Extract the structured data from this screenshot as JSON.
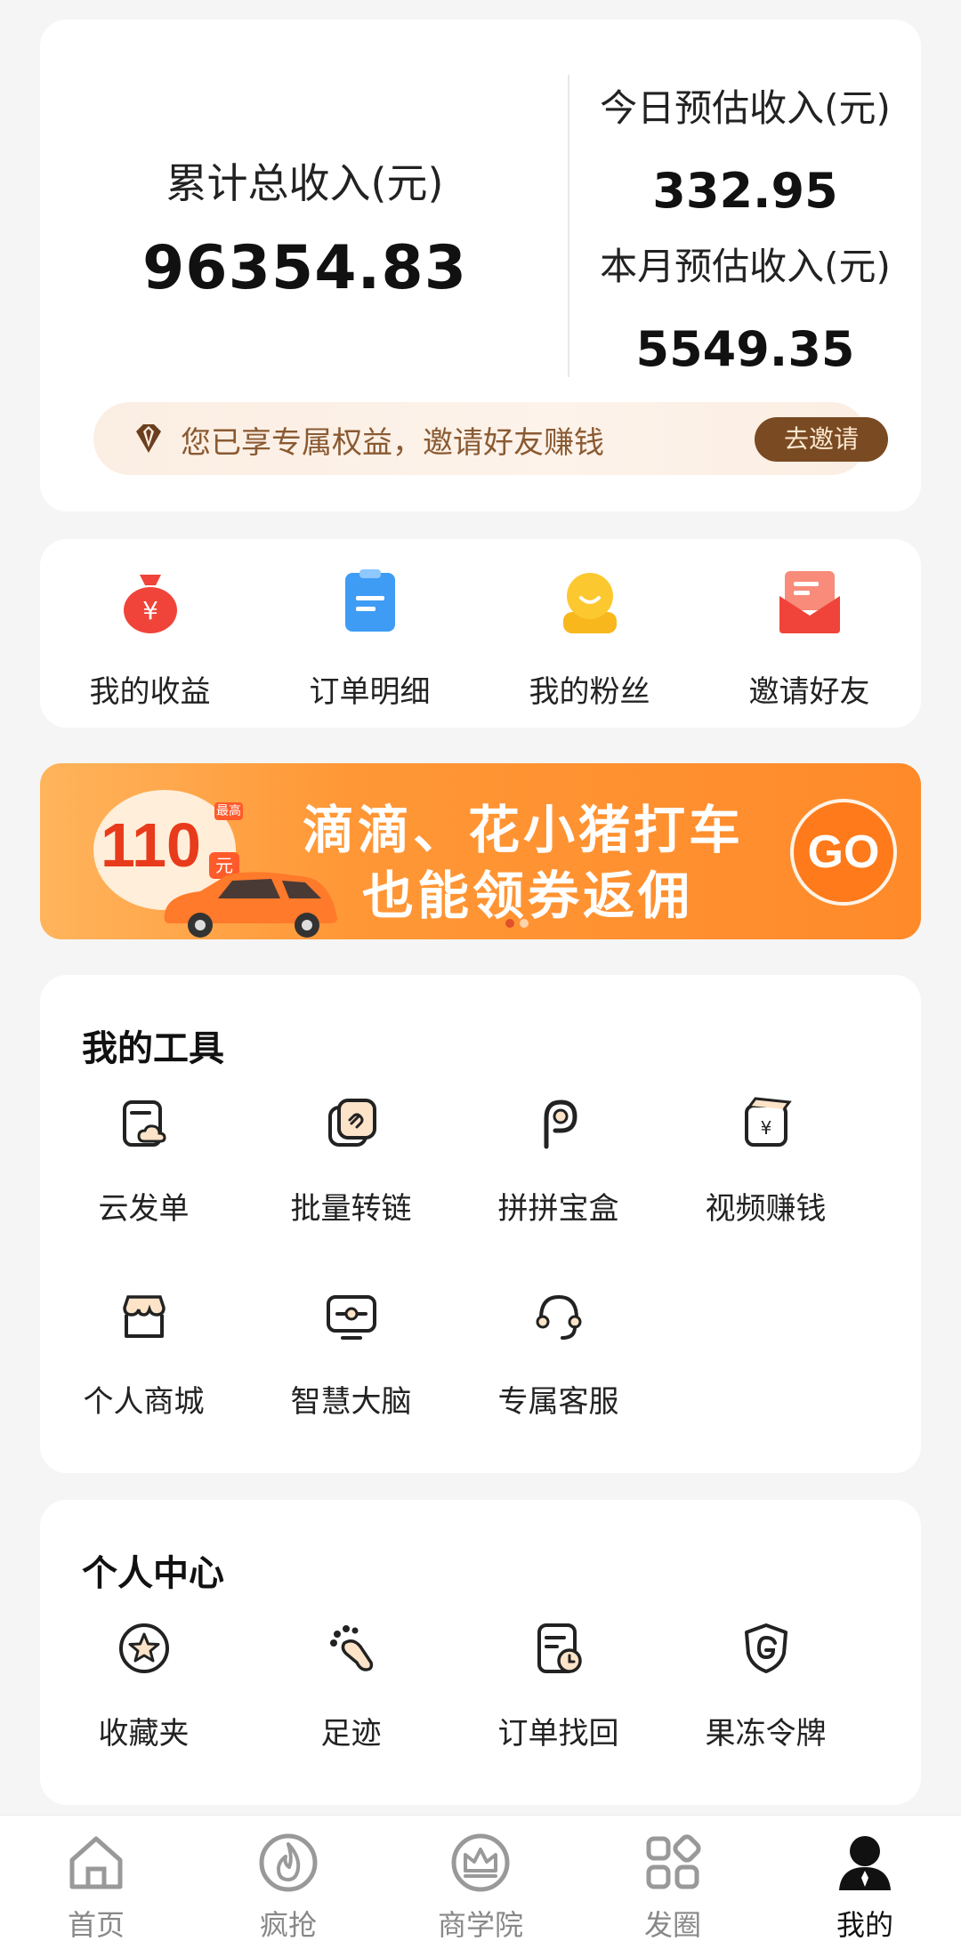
{
  "earnings": {
    "total_label": "累计总收入(元)",
    "total_value": "96354.83",
    "today_label": "今日预估收入(元)",
    "today_value": "332.95",
    "month_label": "本月预估收入(元)",
    "month_value": "5549.35",
    "invite_text": "您已享专属权益，邀请好友赚钱",
    "invite_button": "去邀请"
  },
  "quick_actions": [
    {
      "label": "我的收益",
      "icon": "money-bag-icon",
      "color": "#f0443a"
    },
    {
      "label": "订单明细",
      "icon": "clipboard-icon",
      "color": "#3f9cf5"
    },
    {
      "label": "我的粉丝",
      "icon": "fan-smiley-icon",
      "color": "#f7b71d"
    },
    {
      "label": "邀请好友",
      "icon": "envelope-icon",
      "color": "#f5604a"
    }
  ],
  "promo": {
    "amount": "110",
    "tag": "最高",
    "unit": "元",
    "line1": "滴滴、花小猪打车",
    "line2": "也能领券返佣",
    "go": "GO",
    "slide_count": 2,
    "active_slide": 1
  },
  "tools": {
    "title": "我的工具",
    "items": [
      {
        "label": "云发单",
        "icon": "cloud-doc-icon"
      },
      {
        "label": "批量转链",
        "icon": "link-convert-icon"
      },
      {
        "label": "拼拼宝盒",
        "icon": "pinpin-p-icon"
      },
      {
        "label": "视频赚钱",
        "icon": "video-money-icon"
      },
      {
        "label": "个人商城",
        "icon": "shop-icon"
      },
      {
        "label": "智慧大脑",
        "icon": "brain-screen-icon"
      },
      {
        "label": "专属客服",
        "icon": "headset-icon"
      }
    ]
  },
  "personal_center": {
    "title": "个人中心",
    "items": [
      {
        "label": "收藏夹",
        "icon": "star-icon"
      },
      {
        "label": "足迹",
        "icon": "footprint-icon"
      },
      {
        "label": "订单找回",
        "icon": "order-retrieve-icon"
      },
      {
        "label": "果冻令牌",
        "icon": "shield-g-icon"
      }
    ]
  },
  "bottom_nav": [
    {
      "label": "首页",
      "icon": "home-icon"
    },
    {
      "label": "疯抢",
      "icon": "flame-icon"
    },
    {
      "label": "商学院",
      "icon": "crown-icon"
    },
    {
      "label": "发圈",
      "icon": "grid-icon"
    },
    {
      "label": "我的",
      "icon": "user-icon",
      "active": true
    }
  ],
  "colors": {
    "accent_brown": "#7a4a22",
    "promo_orange": "#ff8a2a"
  }
}
